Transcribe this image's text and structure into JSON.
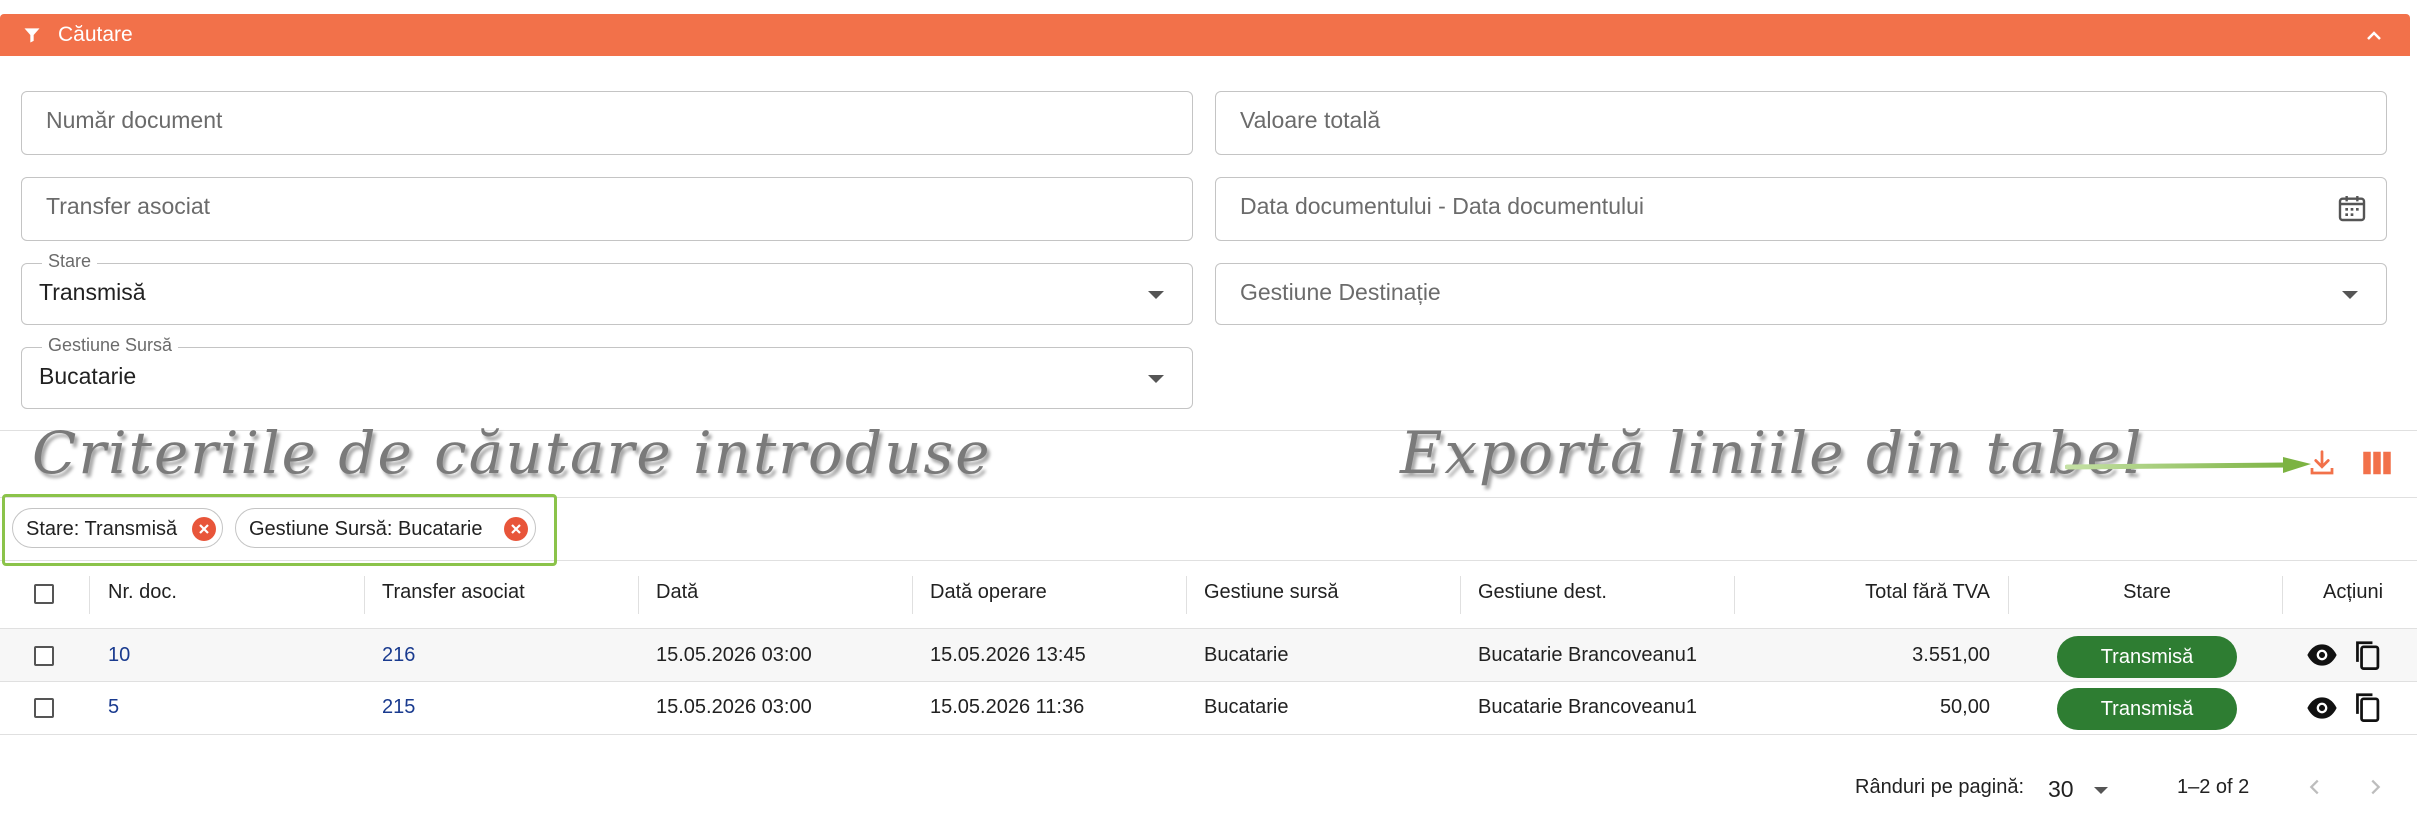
{
  "search": {
    "title": "Căutare",
    "fields": {
      "document_number_placeholder": "Număr document",
      "total_value_placeholder": "Valoare totală",
      "associated_transfer_placeholder": "Transfer asociat",
      "date_range_placeholder": "Data documentului - Data documentului",
      "status_label": "Stare",
      "status_value": "Transmisă",
      "destination_placeholder": "Gestiune Destinație",
      "source_label": "Gestiune Sursă",
      "source_value": "Bucatarie"
    }
  },
  "annotations": {
    "criteria": "Criteriile de căutare introduse",
    "export": "Exportă liniile din tabel"
  },
  "chips": [
    {
      "label": "Stare: Transmisă"
    },
    {
      "label": "Gestiune Sursă: Bucatarie"
    }
  ],
  "table": {
    "columns": [
      "Nr. doc.",
      "Transfer asociat",
      "Dată",
      "Dată operare",
      "Gestiune sursă",
      "Gestiune dest.",
      "Total fără TVA",
      "Stare",
      "Acțiuni"
    ],
    "rows": [
      {
        "doc": "10",
        "transfer": "216",
        "date": "15.05.2026 03:00",
        "op_date": "15.05.2026 13:45",
        "source": "Bucatarie",
        "dest": "Bucatarie Brancoveanu1",
        "total": "3.551,00",
        "status": "Transmisă"
      },
      {
        "doc": "5",
        "transfer": "215",
        "date": "15.05.2026 03:00",
        "op_date": "15.05.2026 11:36",
        "source": "Bucatarie",
        "dest": "Bucatarie Brancoveanu1",
        "total": "50,00",
        "status": "Transmisă"
      }
    ]
  },
  "pagination": {
    "rows_per_page_label": "Rânduri pe pagină:",
    "rows_per_page_value": "30",
    "range": "1–2 of 2"
  },
  "colors": {
    "header": "#f2714a",
    "status": "#2e7d32",
    "link": "#1a3b8f",
    "highlight": "#8bc34a"
  }
}
